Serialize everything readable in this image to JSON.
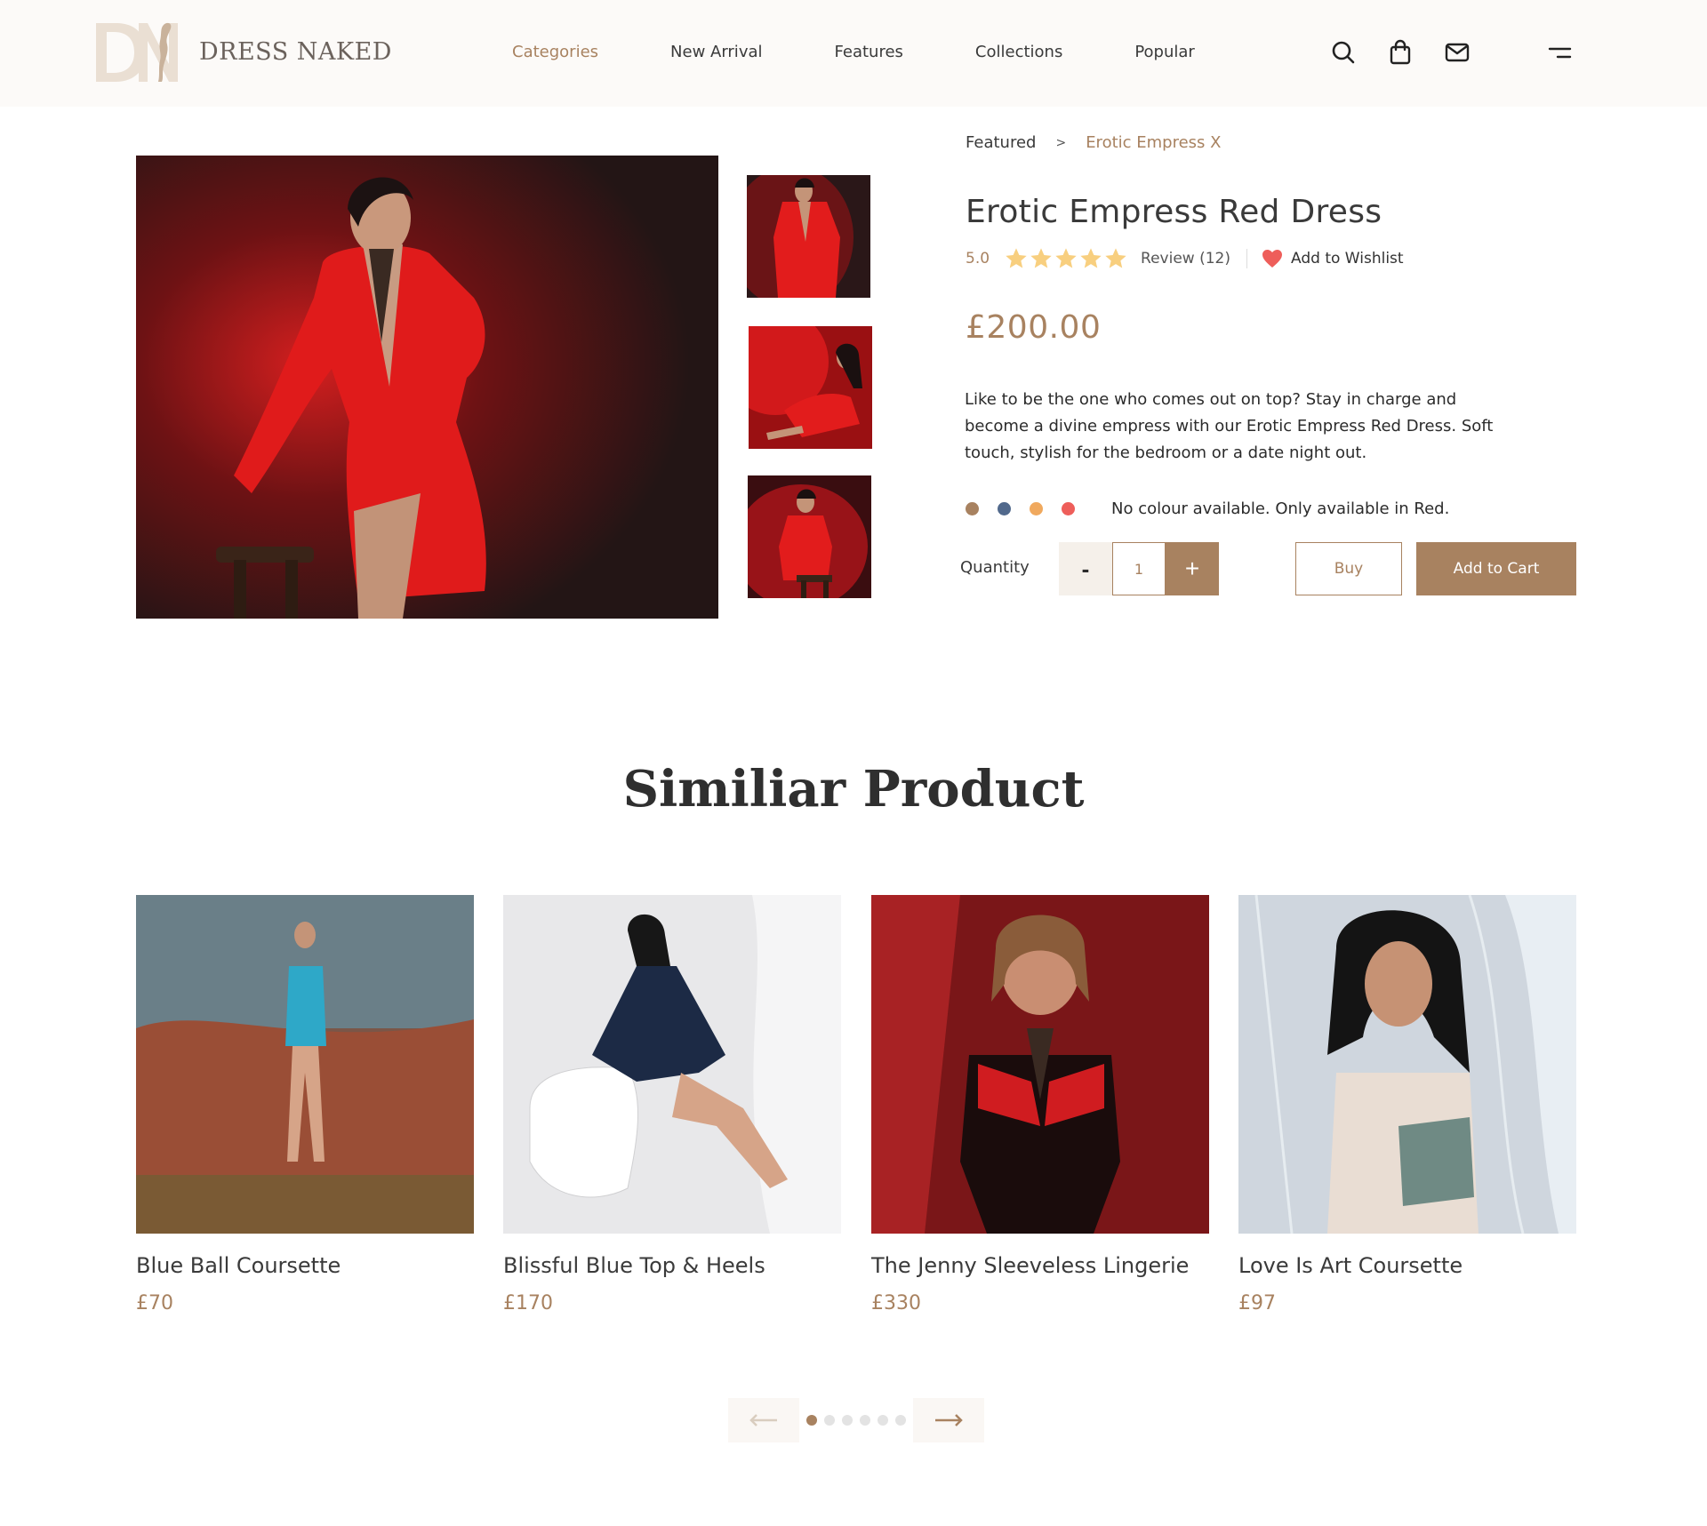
{
  "header": {
    "brand": "DRESS NAKED",
    "nav": [
      "Categories",
      "New Arrival",
      "Features",
      "Collections",
      "Popular"
    ],
    "active_nav": "Categories",
    "icons": [
      "search-icon",
      "shopping-bag-icon",
      "mail-icon",
      "menu-icon"
    ]
  },
  "breadcrumb": {
    "parent": "Featured",
    "separator": ">",
    "current": "Erotic Empress X"
  },
  "product": {
    "title": "Erotic Empress Red Dress",
    "rating": "5.0",
    "stars": 5,
    "reviews": "Review (12)",
    "wishlist_label": "Add to Wishlist",
    "price": "£200.00",
    "description": "Like to be the one who comes out on top? Stay in charge and become a divine empress with our Erotic Empress Red Dress. Soft touch, stylish for the bedroom or a date night out.",
    "colours": [
      "#a88260",
      "#51698c",
      "#f0a95e",
      "#ee5e5a"
    ],
    "colour_note": "No colour available. Only available in Red.",
    "quantity_label": "Quantity",
    "quantity": "1",
    "minus": "-",
    "plus": "+",
    "buy_label": "Buy",
    "cart_label": "Add to Cart"
  },
  "similar": {
    "title": "Similiar Product",
    "items": [
      {
        "name": "Blue Ball Coursette",
        "price": "£70"
      },
      {
        "name": "Blissful Blue Top & Heels",
        "price": "£170"
      },
      {
        "name": "The Jenny Sleeveless Lingerie",
        "price": "£330"
      },
      {
        "name": "Love Is Art Coursette",
        "price": "£97"
      }
    ],
    "pager": {
      "pages": 6,
      "active": 1
    }
  },
  "colors": {
    "accent": "#a88260",
    "star": "#f8cf7f",
    "heart": "#ee5e5a"
  }
}
